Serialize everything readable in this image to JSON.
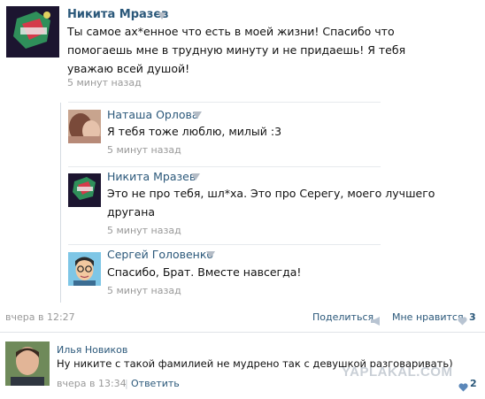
{
  "thread": {
    "post": {
      "author": "Никита Мразев",
      "lines": [
        "Ты самое ах*енное что есть в моей жизни! Спасибо что",
        "помогаешь мне в трудную минуту и не придаешь! Я тебя",
        "уважаю всей душой!"
      ],
      "time": "5 минут назад"
    },
    "replies": [
      {
        "author": "Наташа Орлова",
        "lines": [
          "Я тебя тоже люблю, милый :3"
        ],
        "time": "5 минут назад"
      },
      {
        "author": "Никита Мразев",
        "lines": [
          "Это не про тебя, шл*ха. Это про Серегу, моего лучшего",
          "другана"
        ],
        "time": "5 минут назад"
      },
      {
        "author": "Сергей Головенко",
        "lines": [
          "Спасибо, Брат. Вместе навсегда!"
        ],
        "time": "5 минут назад"
      }
    ],
    "footer": {
      "date": "вчера в 12:27",
      "share_label": "Поделиться",
      "like_label": "Мне нравится",
      "like_count": "3"
    }
  },
  "comment": {
    "author": "Илья Новиков",
    "text": "Ну никите с такой фамилией не мудрено так с девушкой разговаривать)",
    "date": "вчера в 13:34",
    "separator": "|",
    "reply_label": "Ответить",
    "like_count": "2"
  },
  "watermark": "YAPLAKAL.COM",
  "colors": {
    "link": "#2b587a",
    "muted": "#999999",
    "heart": "#5b87b9"
  }
}
